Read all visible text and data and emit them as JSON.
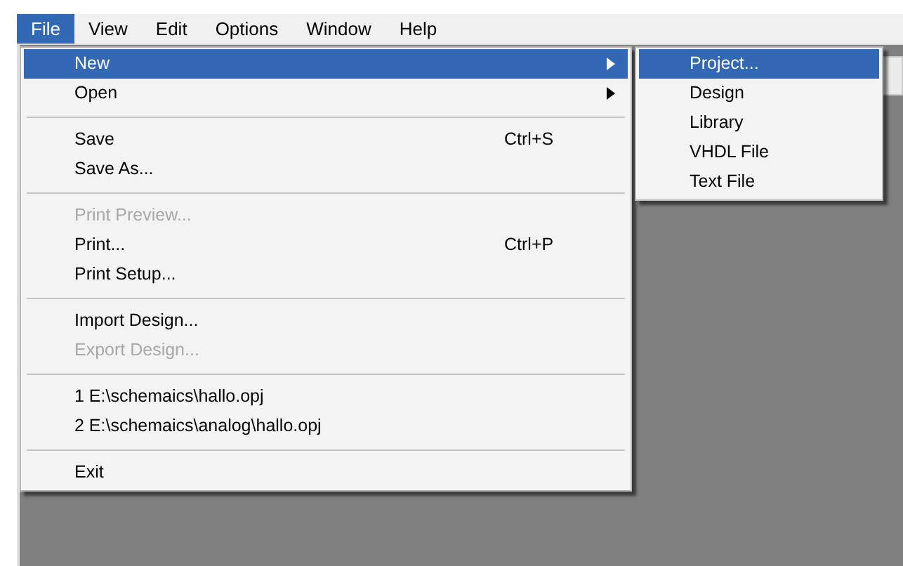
{
  "menu_bar": [
    {
      "label": "File",
      "selected": true
    },
    {
      "label": "View",
      "selected": false
    },
    {
      "label": "Edit",
      "selected": false
    },
    {
      "label": "Options",
      "selected": false
    },
    {
      "label": "Window",
      "selected": false
    },
    {
      "label": "Help",
      "selected": false
    }
  ],
  "file_menu": {
    "items": [
      {
        "kind": "item",
        "label": "New",
        "has_submenu": true,
        "selected": true,
        "disabled": false
      },
      {
        "kind": "item",
        "label": "Open",
        "has_submenu": true,
        "selected": false,
        "disabled": false
      },
      {
        "kind": "separator"
      },
      {
        "kind": "item",
        "label": "Save",
        "shortcut": "Ctrl+S",
        "has_submenu": false,
        "selected": false,
        "disabled": false
      },
      {
        "kind": "item",
        "label": "Save As...",
        "has_submenu": false,
        "selected": false,
        "disabled": false
      },
      {
        "kind": "separator"
      },
      {
        "kind": "item",
        "label": "Print Preview...",
        "has_submenu": false,
        "selected": false,
        "disabled": true
      },
      {
        "kind": "item",
        "label": "Print...",
        "shortcut": "Ctrl+P",
        "has_submenu": false,
        "selected": false,
        "disabled": false
      },
      {
        "kind": "item",
        "label": "Print Setup...",
        "has_submenu": false,
        "selected": false,
        "disabled": false
      },
      {
        "kind": "separator"
      },
      {
        "kind": "item",
        "label": "Import Design...",
        "has_submenu": false,
        "selected": false,
        "disabled": false
      },
      {
        "kind": "item",
        "label": "Export Design...",
        "has_submenu": false,
        "selected": false,
        "disabled": true
      },
      {
        "kind": "separator"
      },
      {
        "kind": "item",
        "label": "1 E:\\schemaics\\hallo.opj",
        "has_submenu": false,
        "selected": false,
        "disabled": false
      },
      {
        "kind": "item",
        "label": "2 E:\\schemaics\\analog\\hallo.opj",
        "has_submenu": false,
        "selected": false,
        "disabled": false
      },
      {
        "kind": "separator"
      },
      {
        "kind": "item",
        "label": "Exit",
        "has_submenu": false,
        "selected": false,
        "disabled": false
      }
    ]
  },
  "new_submenu": {
    "items": [
      {
        "label": "Project...",
        "selected": true
      },
      {
        "label": "Design",
        "selected": false
      },
      {
        "label": "Library",
        "selected": false
      },
      {
        "label": "VHDL File",
        "selected": false
      },
      {
        "label": "Text File",
        "selected": false
      }
    ]
  }
}
